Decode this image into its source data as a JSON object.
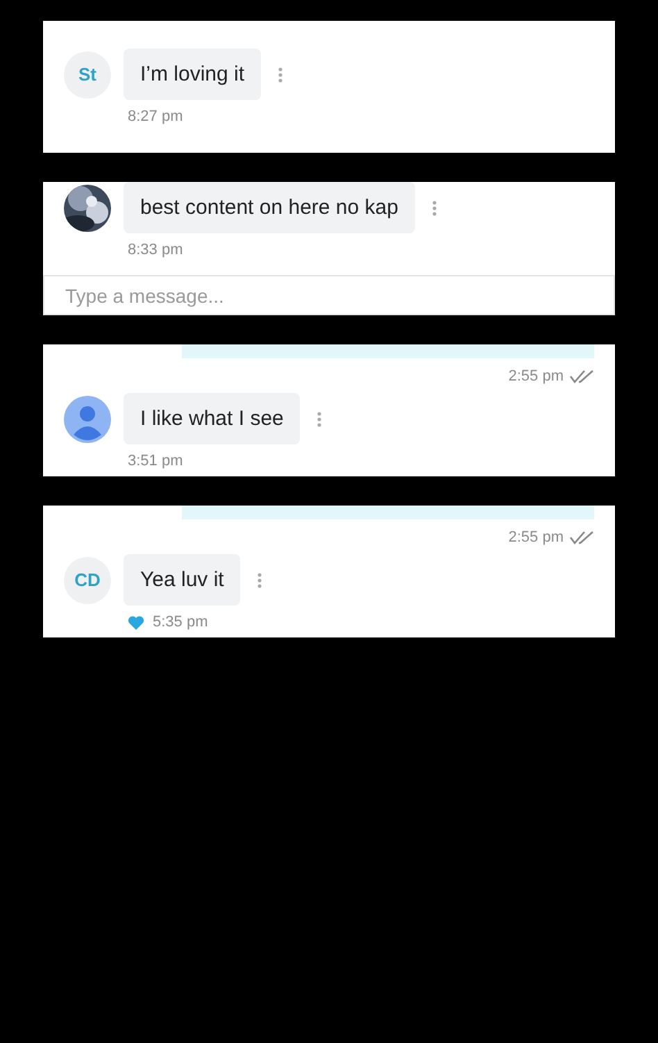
{
  "panels": [
    {
      "message": {
        "avatar": {
          "kind": "initials",
          "text": "St"
        },
        "text": "I’m loving it",
        "time": "8:27 pm",
        "liked": false
      }
    },
    {
      "message": {
        "text": "best content on here no kap",
        "time": "8:33 pm",
        "liked": false
      },
      "composer": {
        "placeholder": "Type a message..."
      }
    },
    {
      "sent": {
        "time": "2:55 pm"
      },
      "message": {
        "avatar": {
          "kind": "person"
        },
        "text": "I like what I see",
        "time": "3:51 pm",
        "liked": false
      }
    },
    {
      "sent": {
        "time": "2:55 pm"
      },
      "message": {
        "avatar": {
          "kind": "initials",
          "text": "CD"
        },
        "text": "Yea luv it",
        "time": "5:35 pm",
        "liked": true
      }
    }
  ]
}
